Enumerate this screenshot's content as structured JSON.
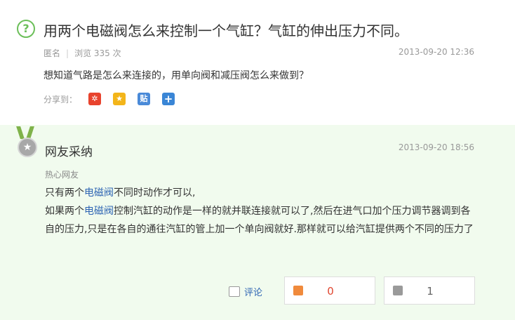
{
  "question": {
    "icon": "question-circle-icon",
    "title": "用两个电磁阀怎么来控制一个气缸？气缸的伸出压力不同。",
    "author": "匿名",
    "views": "浏览 335 次",
    "time": "2013-09-20 12:36",
    "body": "想知道气路是怎么来连接的，用单向阀和减压阀怎么来做到？",
    "share_label": "分享到：",
    "share_icons": [
      "weibo-icon",
      "qzone-icon",
      "tieba-icon",
      "plus-icon"
    ]
  },
  "answer": {
    "badge": "网友采纳",
    "time": "2013-09-20 18:56",
    "user": "热心网友",
    "line1_a": "只有两个",
    "line1_kw": "电磁阀",
    "line1_b": "不同时动作才可以,",
    "line2_a": "如果两个",
    "line2_kw": "电磁阀",
    "line2_b": "控制汽缸的动作是一样的就并联连接就可以了,然后在进气口加个压力调节器调到各自的压力,只是在各自的通往汽缸的管上加一个单向阀就好.那样就可以给汽缸提供两个不同的压力了",
    "comment_label": "评论",
    "upvotes": "0",
    "downvotes": "1"
  },
  "colors": {
    "accent_green": "#6cbf5a",
    "answer_bg": "#f1fbee",
    "link_blue": "#2d64b3",
    "upvote_red": "#e0452f"
  }
}
